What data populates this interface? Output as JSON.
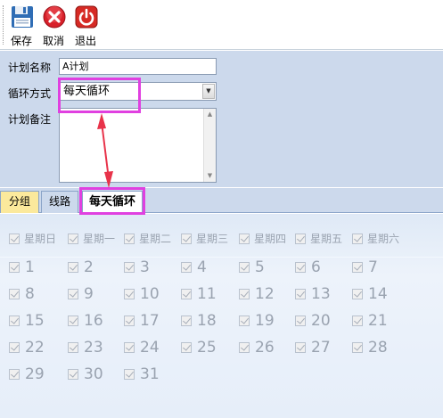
{
  "toolbar": {
    "save_label": "保存",
    "cancel_label": "取消",
    "exit_label": "退出",
    "save_icon": "floppy-disk-icon",
    "cancel_icon": "cancel-x-icon",
    "exit_icon": "power-icon"
  },
  "form": {
    "name_label": "计划名称",
    "name_value": "A计划",
    "cycle_label": "循环方式",
    "cycle_value": "每天循环",
    "remark_label": "计划备注",
    "remark_value": ""
  },
  "tabs": {
    "group": "分组",
    "route": "线路",
    "daily": "每天循环"
  },
  "weekdays": [
    "星期日",
    "星期一",
    "星期二",
    "星期三",
    "星期四",
    "星期五",
    "星期六"
  ],
  "days": [
    "1",
    "2",
    "3",
    "4",
    "5",
    "6",
    "7",
    "8",
    "9",
    "10",
    "11",
    "12",
    "13",
    "14",
    "15",
    "16",
    "17",
    "18",
    "19",
    "20",
    "21",
    "22",
    "23",
    "24",
    "25",
    "26",
    "27",
    "28",
    "29",
    "30",
    "31"
  ],
  "colors": {
    "highlight": "#e040e0",
    "arrow": "#e8334a",
    "form_bg": "#ccd9ec",
    "active_tab": "#fbe99c"
  }
}
